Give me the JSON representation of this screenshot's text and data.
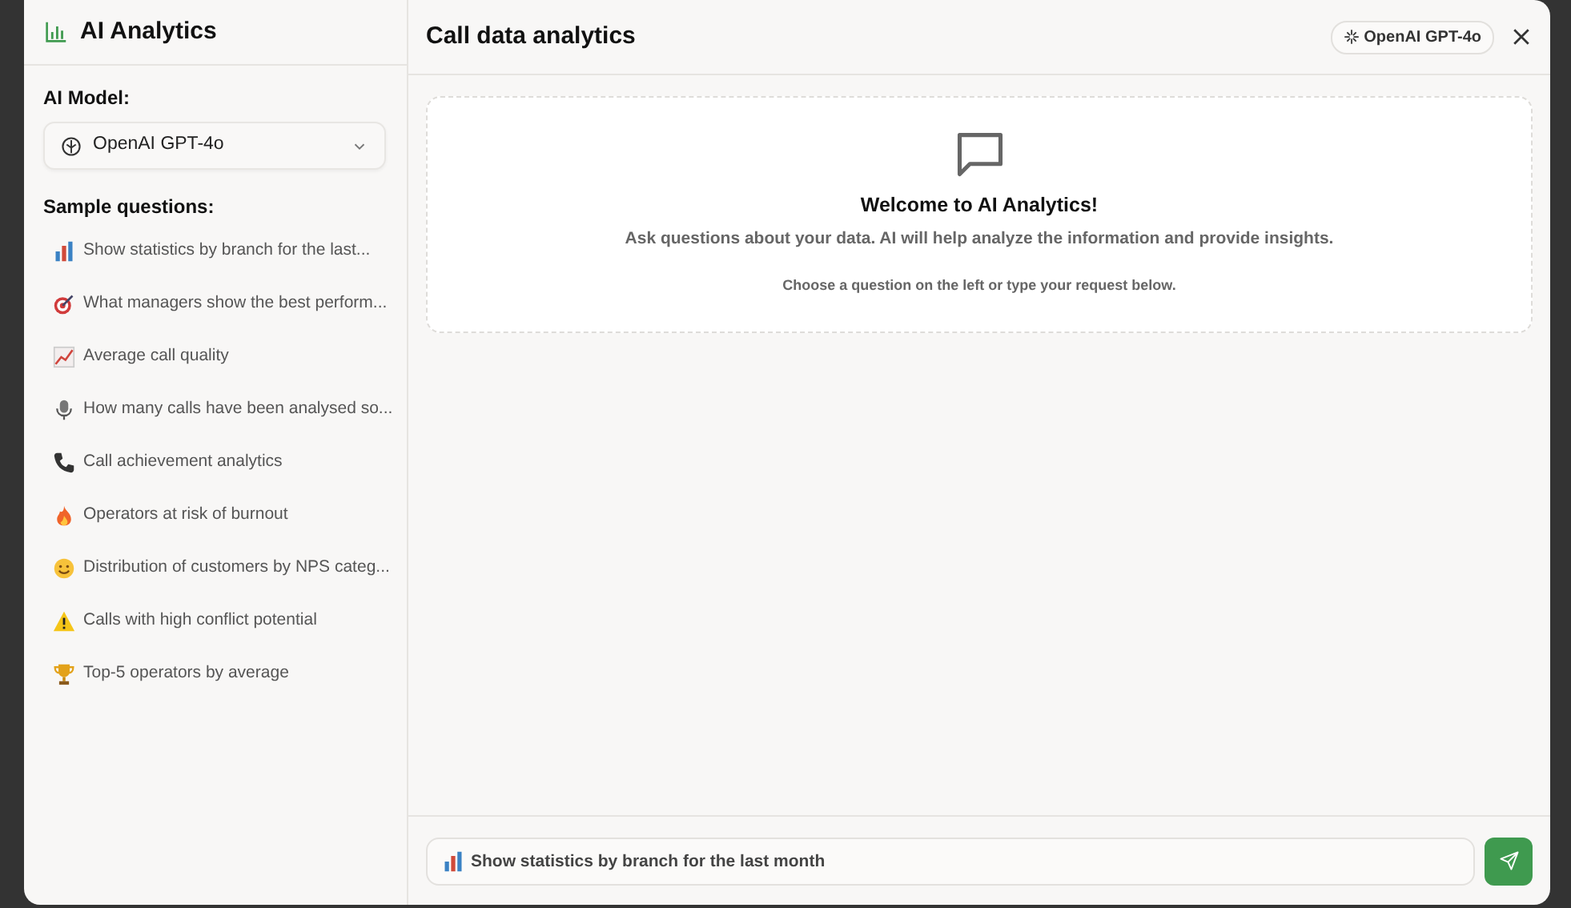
{
  "sidebar": {
    "title": "AI Analytics",
    "model_label": "AI Model:",
    "model_select": {
      "value": "OpenAI GPT-4o"
    },
    "questions_label": "Sample questions:",
    "questions": [
      {
        "kind": "bar-chart",
        "text": "Show statistics by branch for the last..."
      },
      {
        "kind": "target",
        "text": "What managers show the best perform..."
      },
      {
        "kind": "line-chart",
        "text": "Average call quality"
      },
      {
        "kind": "microphone",
        "text": "How many calls have been analysed so..."
      },
      {
        "kind": "phone",
        "text": "Call achievement analytics"
      },
      {
        "kind": "flame",
        "text": "Operators at risk of burnout"
      },
      {
        "kind": "smiley",
        "text": "Distribution of customers by NPS categ..."
      },
      {
        "kind": "warning",
        "text": "Calls with high conflict potential"
      },
      {
        "kind": "trophy",
        "text": "Top-5 operators by average"
      }
    ]
  },
  "main": {
    "title": "Call data analytics",
    "model_badge": "OpenAI GPT-4o",
    "welcome": {
      "heading": "Welcome to AI Analytics!",
      "text": "Ask questions about your data. AI will help analyze the information and provide insights.",
      "hint": "Choose a question on the left or type your request below."
    },
    "input": {
      "kind": "bar-chart",
      "value": "Show statistics by branch for the last month"
    }
  }
}
